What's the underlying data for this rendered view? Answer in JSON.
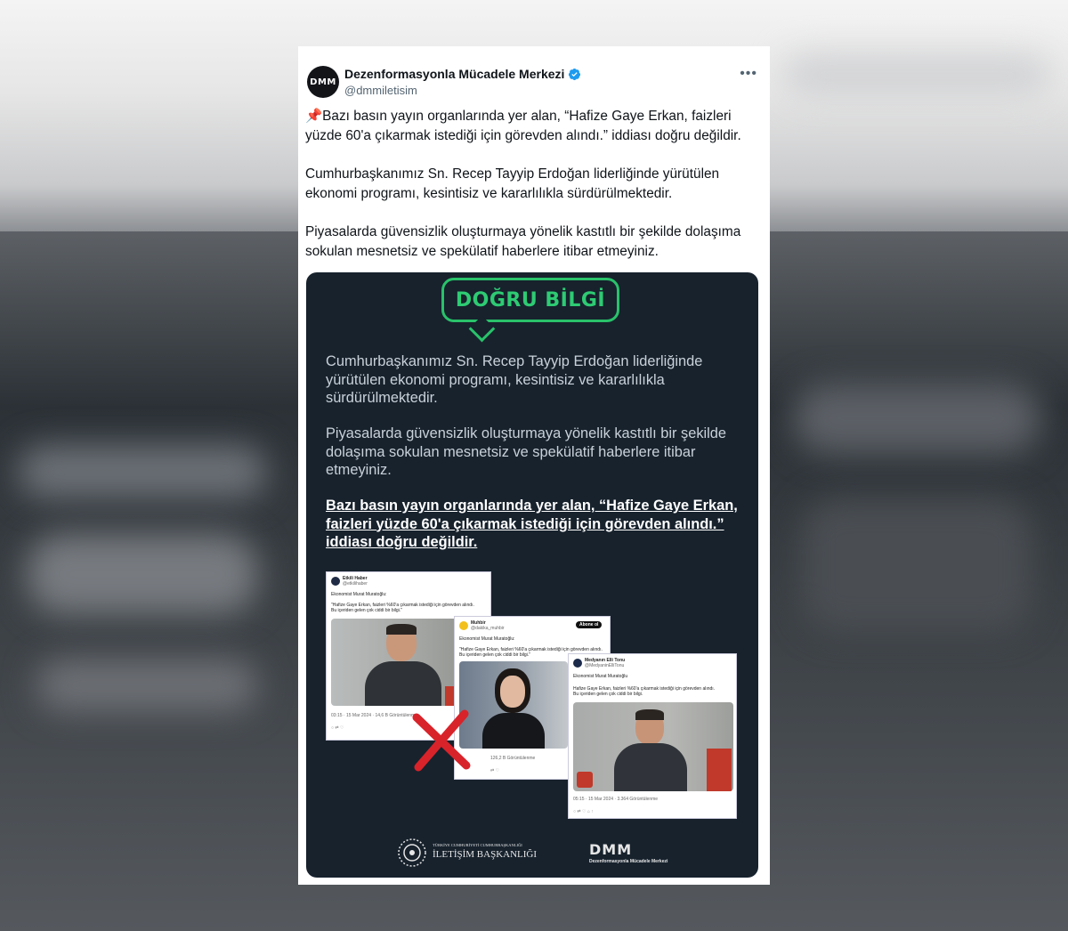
{
  "tweet": {
    "author_name": "Dezenformasyonla Mücadele Merkezi",
    "author_handle": "@dmmiletisim",
    "avatar_text": "DMM",
    "more_icon": "•••",
    "paragraphs": [
      "📌Bazı basın yayın organlarında yer alan, “Hafize Gaye Erkan, faizleri yüzde 60'a çıkarmak istediği için görevden alındı.” iddiası doğru değildir.",
      "Cumhurbaşkanımız Sn. Recep Tayyip Erdoğan liderliğinde yürütülen ekonomi programı, kesintisiz ve kararlılıkla sürdürülmektedir.",
      "Piyasalarda güvensizlik oluşturmaya yönelik kastıtlı bir şekilde dolaşıma sokulan mesnetsiz ve spekülatif haberlere itibar etmeyiniz."
    ]
  },
  "media": {
    "badge": "DOĞRU BİLGİ",
    "text1": "Cumhurbaşkanımız Sn. Recep Tayyip Erdoğan liderliğinde yürütülen ekonomi programı, kesintisiz ve kararlılıkla sürdürülmektedir.",
    "text2": "Piyasalarda güvensizlik oluşturmaya yönelik kastıtlı bir şekilde dolaşıma sokulan mesnetsiz ve spekülatif haberlere itibar etmeyiniz.",
    "text3": "Bazı basın yayın organlarında yer alan, “Hafize Gaye Erkan, faizleri yüzde 60'a çıkarmak istediği için görevden alındı.” iddiası doğru değildir.",
    "shots": [
      {
        "name": "Etkili Haber",
        "handle": "@etkilihaber",
        "line1": "Ekonomist Murat Muratoğlu:",
        "line2": "\"Hafize Gaye Erkan, faizleri %60'a çıkarmak istediği için görevden alındı.",
        "line3": "Bu içeriden gelen çok ciddi bir bilgi.\"",
        "stats": "03:15 · 15 Mar 2024 · 14,6 B Görüntülenme"
      },
      {
        "name": "Muhbir",
        "handle": "@dakika_muhbir",
        "follow": "Abone ol",
        "line1": "Ekonomist Murat Muratoğlu:",
        "line2": "\"Hafize Gaye Erkan, faizleri %60'a çıkarmak istediği için görevden alındı.",
        "line3": "Bu içeriden gelen çok ciddi bir bilgi.\"",
        "stats": "126,2 B Görüntülenme"
      },
      {
        "name": "Medyanın Elli Tonu",
        "handle": "@MedyaninElliTonu",
        "line1": "Ekonomist Murat Muratoğlu",
        "line2": "Hafize Gaye Erkan, faizleri %60'a çıkarmak istediği için görevden alındı.",
        "line3": "Bu içeriden gelen çok ciddi bir bilgi.",
        "stats": "05:15 · 15 Mar 2024 · 3.364 Görüntülenme"
      }
    ],
    "footer_left_line1": "TÜRKİYE CUMHURİYETİ CUMHURBAŞKANLIĞI",
    "footer_left_line2": "İLETİŞİM BAŞKANLIĞI",
    "footer_right_line1": "DMM",
    "footer_right_line2": "Dezenformasyonla Mücadele Merkezi"
  },
  "colors": {
    "accent": "#1d9bf0",
    "badge_green": "#29c26a",
    "media_bg": "#17222d",
    "cross_red": "#d8232a"
  }
}
